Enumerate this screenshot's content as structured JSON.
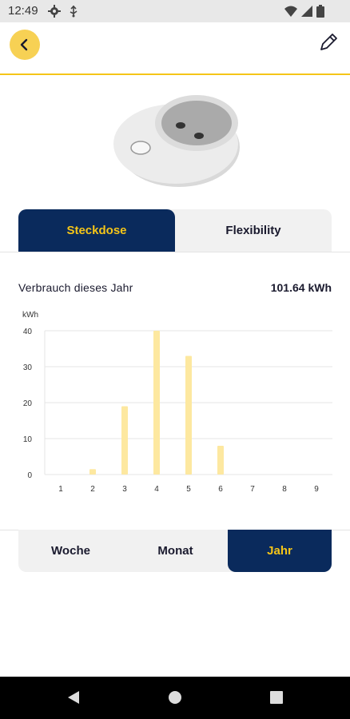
{
  "status_bar": {
    "time": "12:49",
    "icons": [
      "gear-icon",
      "usb-icon",
      "wifi-icon",
      "signal-icon",
      "battery-icon"
    ]
  },
  "app_bar": {
    "back_icon": "chevron-left-icon",
    "edit_icon": "pencil-icon",
    "accent_color": "#f5c518"
  },
  "device": {
    "image": "smart-plug-illustration"
  },
  "tabs": [
    {
      "label": "Steckdose",
      "active": true
    },
    {
      "label": "Flexibility",
      "active": false
    }
  ],
  "usage": {
    "label": "Verbrauch dieses Jahr",
    "value": "101.64 kWh"
  },
  "chart_data": {
    "type": "bar",
    "ylabel": "kWh",
    "categories": [
      "1",
      "2",
      "3",
      "4",
      "5",
      "6",
      "7",
      "8",
      "9"
    ],
    "values": [
      0,
      1.5,
      19,
      40,
      33,
      8,
      0,
      0,
      0
    ],
    "ylim": [
      0,
      40
    ],
    "yticks": [
      0,
      10,
      20,
      30,
      40
    ],
    "grid": true,
    "bar_color": "#fde8a0"
  },
  "period_selector": [
    {
      "label": "Woche",
      "active": false
    },
    {
      "label": "Monat",
      "active": false
    },
    {
      "label": "Jahr",
      "active": true
    }
  ],
  "colors": {
    "primary": "#0a2a5c",
    "accent": "#f5c518",
    "back_button": "#f7d154"
  }
}
